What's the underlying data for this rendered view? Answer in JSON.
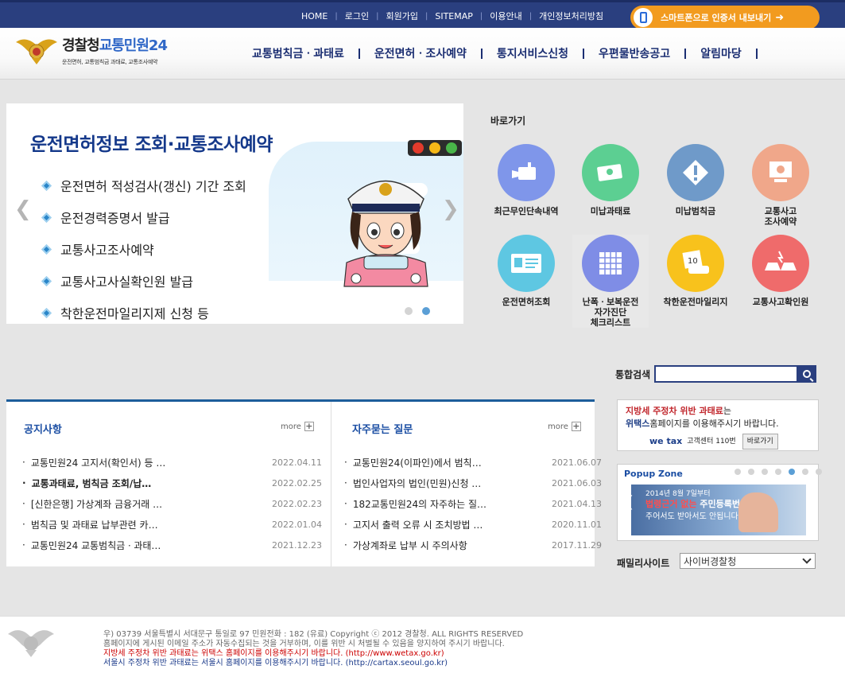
{
  "topbar": {
    "links": [
      "HOME",
      "로그인",
      "회원가입",
      "SITEMAP",
      "이용안내",
      "개인정보처리방침"
    ],
    "smart": {
      "text": "스마트폰으로 인증서 내보내기"
    }
  },
  "logo": {
    "title_a": "경찰청",
    "title_b": "교통민원24",
    "subtitle": "운전면허, 교통범칙금 과태료, 교통조사예약"
  },
  "gnb": [
    "교통범칙금ㆍ과태료",
    "운전면허ㆍ조사예약",
    "통지서비스신청",
    "우편물반송공고",
    "알림마당"
  ],
  "slider": {
    "title": "운전면허정보 조회·교통조사예약",
    "items": [
      "운전면허 적성검사(갱신) 기간 조회",
      "운전경력증명서 발급",
      "교통사고조사예약",
      "교통사고사실확인원 발급",
      "착한운전마일리지제 신청 등"
    ]
  },
  "quick": {
    "title": "바로가기",
    "items": [
      {
        "label": "최근무인단속내역",
        "icon": "camera-icon",
        "color": "#7f96ea"
      },
      {
        "label": "미납과태료",
        "icon": "money-icon",
        "color": "#5ccf92"
      },
      {
        "label": "미납범칙금",
        "icon": "warning-icon",
        "color": "#6f9ac9"
      },
      {
        "label": "교통사고\n조사예약",
        "icon": "computer-icon",
        "color": "#f0a78a"
      },
      {
        "label": "운전면허조회",
        "icon": "id-card-icon",
        "color": "#5ec7e2"
      },
      {
        "label": "난폭ㆍ보복운전\n자가진단\n체크리스트",
        "icon": "checklist-icon",
        "color": "#7f8de6"
      },
      {
        "label": "착한운전마일리지",
        "icon": "mileage-icon",
        "color": "#f8c21c"
      },
      {
        "label": "교통사고확인원",
        "icon": "accident-icon",
        "color": "#ef6b6b"
      }
    ]
  },
  "search": {
    "label": "통합검색",
    "value": ""
  },
  "notice": {
    "title": "공지사항",
    "more": "more",
    "items": [
      {
        "text": "교통민원24 고지서(확인서) 등 …",
        "date": "2022.04.11"
      },
      {
        "text": "교통과태료, 범칙금 조회/납…",
        "date": "2022.02.25"
      },
      {
        "text": "[신한은행] 가상계좌 금융거래 …",
        "date": "2022.02.23"
      },
      {
        "text": "범칙금 및 과태료 납부관련 카…",
        "date": "2022.01.04"
      },
      {
        "text": "교통민원24 교통범칙금ㆍ과태…",
        "date": "2021.12.23"
      }
    ]
  },
  "faq": {
    "title": "자주묻는 질문",
    "more": "more",
    "items": [
      {
        "text": "교통민원24(이파인)에서 범칙…",
        "date": "2021.06.07"
      },
      {
        "text": "법인사업자의 법인(민원)신청 …",
        "date": "2021.06.03"
      },
      {
        "text": "182교통민원24의 자주하는 질…",
        "date": "2021.04.13"
      },
      {
        "text": "고지서 출력 오류 시 조치방법 …",
        "date": "2020.11.01"
      },
      {
        "text": "가상계좌로 납부 시 주의사항",
        "date": "2017.11.29"
      }
    ]
  },
  "banner": {
    "line1_red": "지방세 주정차 위반 과태료",
    "line1_rest": "는",
    "line2_blue": "위택스",
    "line2_rest": "홈페이지를 이용해주시기 바랍니다.",
    "wetax": "we tax",
    "call": "고객센터 110번",
    "btn": "바로가기"
  },
  "popup": {
    "title": "Popup Zone",
    "dots": 7,
    "active": 4,
    "img_line1": "2014년 8월 7일부터",
    "img_line2a": "법령근거 없는",
    "img_line2b": " 주민등록번호",
    "img_line3": "주어서도 받아서도 안됩니다."
  },
  "family": {
    "label": "패밀리사이트",
    "selected": "사이버경찰청"
  },
  "footer": {
    "line1": "우) 03739 서울특별시 서대문구 통일로 97   민원전화 : 182 (유료)       Copyright ⓒ 2012 경찰청. ALL RIGHTS RESERVED",
    "line2": "홈페이지에 게시된 이메일 주소가 자동수집되는 것을 거부하며, 이를 위반 시 처벌될 수 있음을 양지하여 주시기 바랍니다.",
    "line3": "지방세 주정차 위반 과태료는 위택스 홈페이지를 이용해주시기 바랍니다. (http://www.wetax.go.kr)",
    "line4": "서울시 주정차 위반 과태료는 서울시 홈페이지를 이용해주시기 바랍니다. (http://cartax.seoul.go.kr)"
  },
  "colors": {
    "navy": "#2a3f7f",
    "orange": "#f29b1f",
    "accent": "#1c5d9b"
  }
}
